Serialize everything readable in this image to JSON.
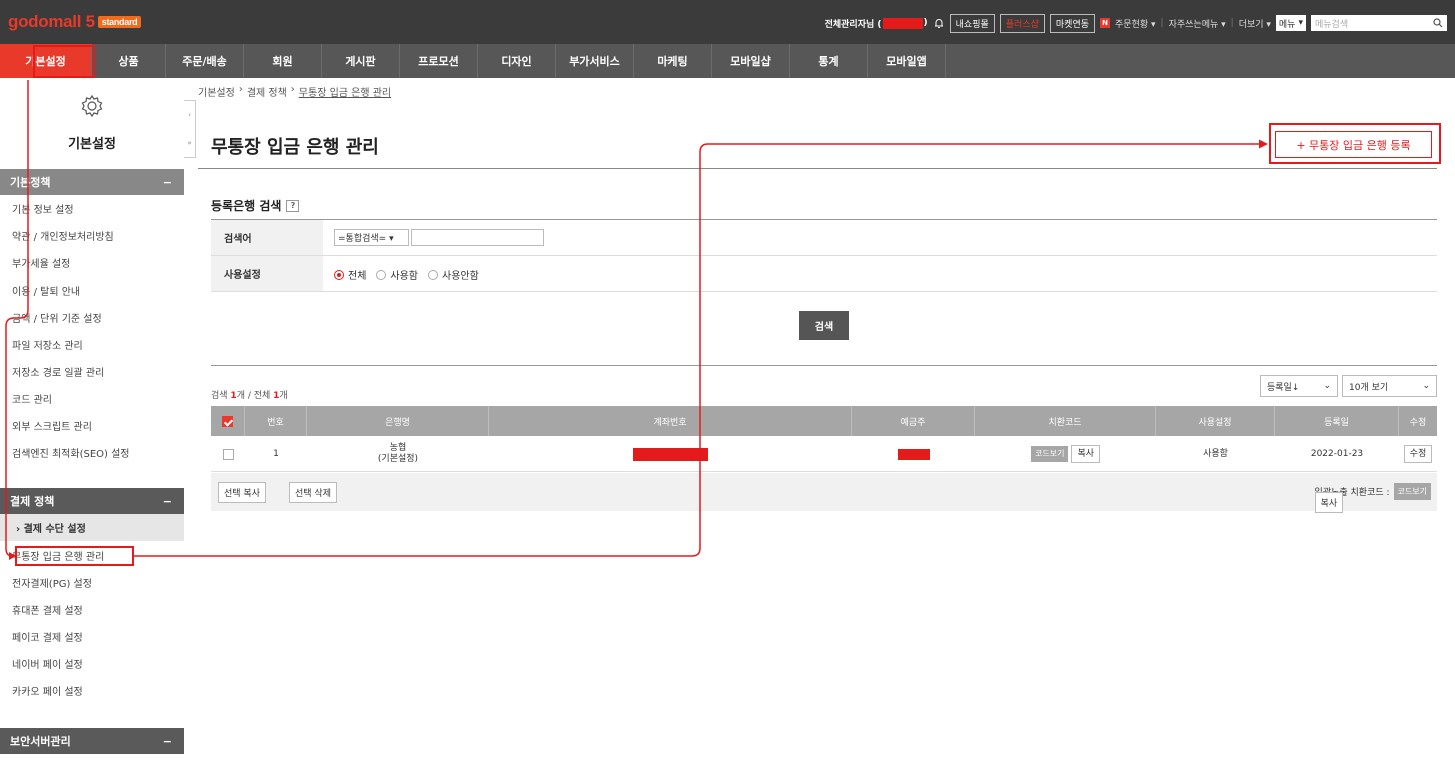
{
  "topbar": {
    "logo": "godomall 5",
    "logo_badge": "standard",
    "admin_prefix": "전체관리자님 (",
    "admin_suffix": ")",
    "buttons": [
      "내쇼핑몰",
      "플러스샵",
      "마켓연동"
    ],
    "menus": [
      "주문현황 ▾",
      "자주쓰는메뉴 ▾",
      "더보기 ▾"
    ],
    "menu_select": "메뉴",
    "menu_search_placeholder": "메뉴검색",
    "order_badge": "N"
  },
  "gnb": [
    "기본설정",
    "상품",
    "주문/배송",
    "회원",
    "게시판",
    "프로모션",
    "디자인",
    "부가서비스",
    "마케팅",
    "모바일샵",
    "통계",
    "모바일앱"
  ],
  "sidebar": {
    "title": "기본설정",
    "sections": [
      {
        "label": "기본정책",
        "toggle": "−"
      },
      {
        "label": "결제 정책",
        "toggle": "−"
      },
      {
        "label": "보안서버관리",
        "toggle": "−"
      }
    ],
    "policy_items": [
      "기본 정보 설정",
      "약관 / 개인정보처리방침",
      "부가세율 설정",
      "이용 / 탈퇴 안내",
      "금액 / 단위 기준 설정",
      "파일 저장소 관리",
      "저장소 경로 일괄 관리",
      "코드 관리",
      "외부 스크립트 관리",
      "검색엔진 최적화(SEO) 설정"
    ],
    "payment_sub": "› 결제 수단 설정",
    "payment_items": [
      "무통장 입금 은행 관리",
      "전자결제(PG) 설정",
      "휴대폰 결제 설정",
      "페이코 결제 설정",
      "네이버 페이 설정",
      "카카오 페이 설정"
    ]
  },
  "breadcrumb": [
    "기본설정",
    "›",
    "결제 정책",
    "›",
    "무통장 입금 은행 관리"
  ],
  "page_title": "무통장 입금 은행 관리",
  "register_button": "+ 무통장 입금 은행 등록",
  "search": {
    "title": "등록은행 검색",
    "help": "?",
    "keyword_label": "검색어",
    "keyword_select": "=통합검색= ▾",
    "keyword_value": "",
    "use_label": "사용설정",
    "radios": [
      "전체",
      "사용함",
      "사용안함"
    ],
    "button": "검색"
  },
  "result": {
    "count_prefix": "검색 ",
    "count_found": "1",
    "count_mid": "개 / 전체 ",
    "count_total": "1",
    "count_suffix": "개",
    "sort": "등록일↓",
    "page_size": "10개 보기"
  },
  "table": {
    "headers": [
      "번호",
      "은행명",
      "계좌번호",
      "예금주",
      "치환코드",
      "사용설정",
      "등록일",
      "수정"
    ],
    "row": {
      "no": "1",
      "bank": "농협",
      "bank_note": "(기본설정)",
      "code_view": "코드보기",
      "copy": "복사",
      "use": "사용함",
      "date": "2022-01-23",
      "edit": "수정"
    }
  },
  "bottom": {
    "copy_selected": "선택 복사",
    "delete_selected": "선택 삭제",
    "bulk_label": "일괄노출 치환코드 :",
    "code_view": "코드보기",
    "copy": "복사"
  },
  "colors": {
    "accent": "#e8392a",
    "annotation": "#e31b1b"
  }
}
